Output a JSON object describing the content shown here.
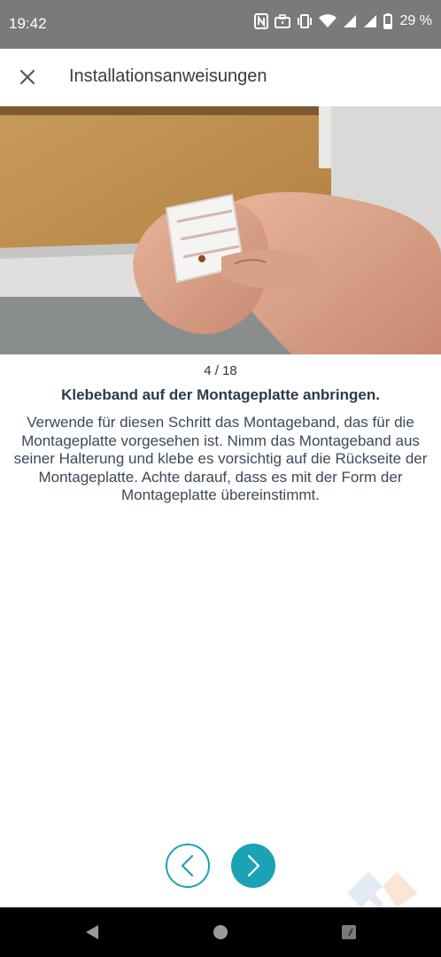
{
  "status_bar": {
    "time": "19:42",
    "battery": "29 %",
    "icons": [
      "nfc-icon",
      "work-profile-icon",
      "vibrate-icon",
      "wifi-icon",
      "signal-icon",
      "signal-icon",
      "battery-icon"
    ]
  },
  "header": {
    "title": "Installationsanweisungen",
    "close_icon": "close-icon"
  },
  "step": {
    "counter": "4 / 18",
    "title": "Klebeband auf der Montageplatte anbringen.",
    "body": "Verwende für diesen Schritt das Montageband, das für die Montageplatte vorgesehen ist. Nimm das Montageband aus seiner Halterung und klebe es vorsichtig auf die Rückseite der Montageplatte. Achte darauf, dass es mit der Form der Montageplatte übereinstimmt."
  },
  "navigation": {
    "prev_icon": "chevron-left-icon",
    "next_icon": "chevron-right-icon"
  },
  "system_nav": {
    "back_icon": "back-icon",
    "home_icon": "home-icon",
    "recents_icon": "recents-icon"
  },
  "colors": {
    "accent": "#1aa3b5",
    "status_bar": "#7a7a7a",
    "title_text": "#2b3a4a",
    "body_text": "#3a4a5a"
  }
}
